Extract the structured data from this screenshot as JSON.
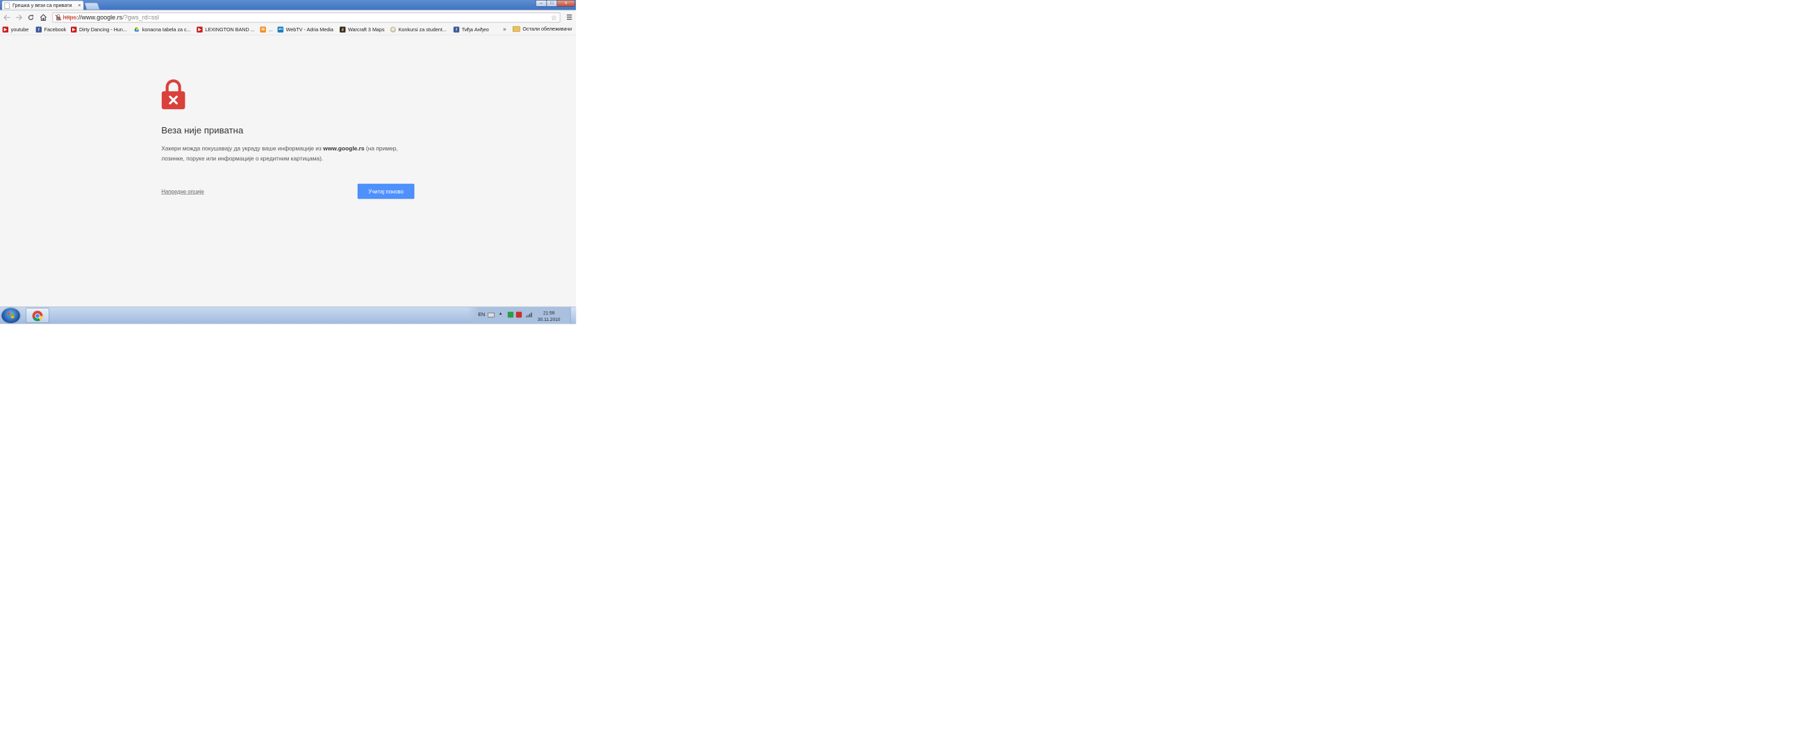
{
  "tab": {
    "title": "Грешка у вези са привати",
    "close_glyph": "×"
  },
  "window": {
    "minimize": "–",
    "maximize": "□",
    "close": "x"
  },
  "omnibox": {
    "scheme": "https",
    "host_prefix": "://www.google.rs",
    "path": "/?gws_rd=ssl"
  },
  "bookmarks": [
    {
      "label": "youtube",
      "icon": "youtube-icon"
    },
    {
      "label": "Facebook",
      "icon": "facebook-icon"
    },
    {
      "label": "Dirty Dancing - Hun...",
      "icon": "youtube-icon"
    },
    {
      "label": "konacna tabela za c...",
      "icon": "google-drive-icon"
    },
    {
      "label": "LEXINGTON BAND ...",
      "icon": "youtube-icon"
    },
    {
      "label": "...",
      "icon": "orange-site-icon"
    },
    {
      "label": "WebTV - Adria Media",
      "icon": "webtv-icon"
    },
    {
      "label": "Warcraft 3 Maps",
      "icon": "warcraft-icon"
    },
    {
      "label": "Konkursi za student...",
      "icon": "gear-site-icon"
    },
    {
      "label": "Тиђа Анђео",
      "icon": "facebook-icon"
    }
  ],
  "bookmarks_more": "»",
  "other_bookmarks": "Остали обележивачи",
  "error": {
    "title": "Веза није приватна",
    "desc_pre": "Хакери можда покушавају да украду ваше информације из ",
    "desc_domain": "www.google.rs",
    "desc_post": " (на пример, лозинке, поруке или информације о кредитним картицама).",
    "advanced_link": "Напредне опције",
    "reload_button": "Учитај поново"
  },
  "colors": {
    "accent_button": "#4d90fe",
    "lock_red": "#d9413a"
  },
  "taskbar": {
    "lang": "EN",
    "time": "21:59",
    "date": "30.11.2010"
  }
}
